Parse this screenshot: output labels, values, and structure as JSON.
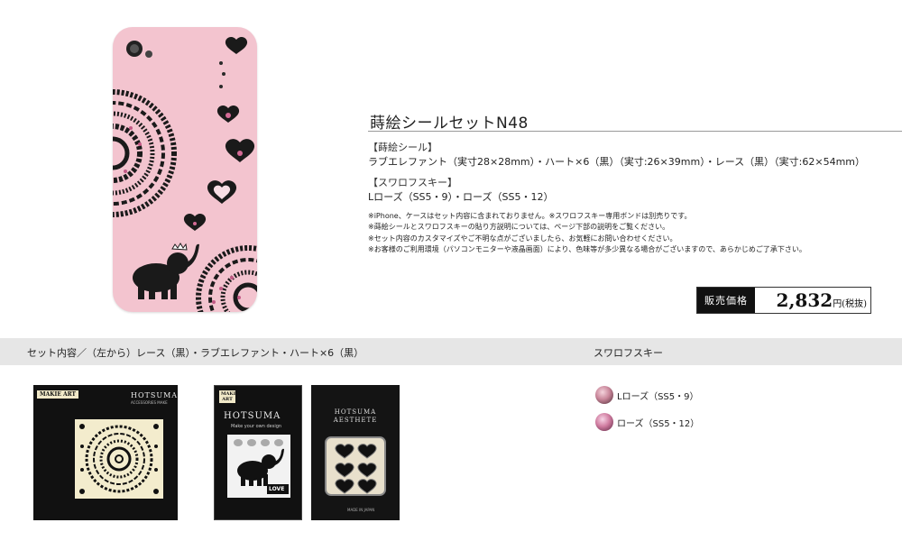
{
  "product": {
    "title": "蒔絵シールセットN48",
    "seal_heading": "【蒔絵シール】",
    "seal_text": "ラブエレファント（実寸28×28mm）・ハート×6（黒）（実寸:26×39mm）・レース（黒）（実寸:62×54mm）",
    "swarovski_heading": "【スワロフスキー】",
    "swarovski_text": "Lローズ（SS5・9）・ローズ（SS5・12）",
    "notes": [
      "※iPhone、ケースはセット内容に含まれておりません。※スワロフスキー専用ボンドは別売りです。",
      "※蒔絵シールとスワロフスキーの貼り方説明については、ページ下部の説明をご覧ください。",
      "※セット内容のカスタマイズやご不明な点がございましたら、お気軽にお問い合わせください。",
      "※お客様のご利用環境（パソコンモニターや液晶画面）により、色味等が多少異なる場合がございますので、あらかじめご了承下さい。"
    ]
  },
  "price": {
    "label": "販売価格",
    "amount": "2,832",
    "unit": "円(税抜)"
  },
  "contents_band": {
    "left_label": "セット内容／（左から）レース（黒）・ラブエレファント・ハート×6（黒）",
    "right_label": "スワロフスキー"
  },
  "packages": [
    {
      "badge": "MAKIE ART",
      "brand": "HOTSUMA",
      "sub": "ACCESSORIES MAKE"
    },
    {
      "badge": "MAKIE ART",
      "brand": "HOTSUMA",
      "sub": "Make your own design",
      "sticker": "LOVE"
    },
    {
      "brand": "HOTSUMA",
      "brand2": "AESTHETE",
      "foot": "MADE IN JAPAN"
    }
  ],
  "crystals": [
    {
      "label": "Lローズ（SS5・9）",
      "color": "#c9869a"
    },
    {
      "label": "ローズ（SS5・12）",
      "color": "#d07ca0"
    }
  ],
  "colors": {
    "case_pink": "#f3c4cf",
    "band_gray": "#e6e6e6",
    "price_label_bg": "#111111"
  }
}
